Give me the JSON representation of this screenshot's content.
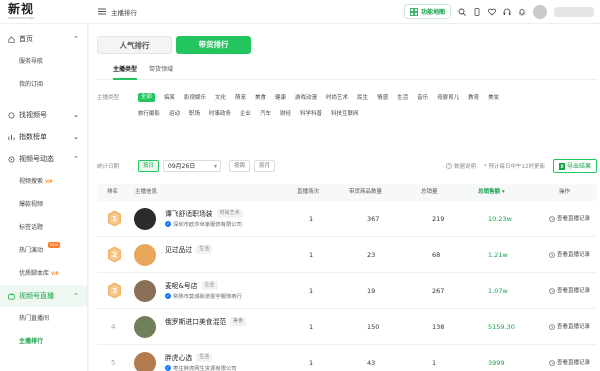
{
  "app": {
    "logo": "新视",
    "logo_sub": "XINSHIDATA.COM"
  },
  "topbar": {
    "breadcrumb_icon": "menu-icon",
    "breadcrumb": "主播排行",
    "func_button": "功能地图"
  },
  "sidebar": {
    "groups": [
      {
        "label": "首页",
        "icon": "home-icon",
        "items": [
          "服务导航",
          "我的订阅"
        ]
      },
      {
        "label": "找视频号",
        "icon": "search-circle-icon"
      },
      {
        "label": "指数榜单",
        "icon": "chart-icon"
      },
      {
        "label": "视频号动态",
        "icon": "video-icon",
        "items": [
          "视频搜索",
          "爆款视频",
          "标签话题",
          "热门演动",
          "优质脚本库"
        ],
        "vip": "VIP",
        "new": "NEW"
      },
      {
        "label": "视频号直播",
        "icon": "live-icon",
        "items": [
          "热门直播间",
          "主播排行"
        ]
      }
    ]
  },
  "main": {
    "tabs": [
      "人气排行",
      "带货排行"
    ],
    "subtabs": [
      "主播类型",
      "带货领域"
    ],
    "filter_label": "主播类型",
    "categories_row1": [
      "全部",
      "搞笑",
      "影视娱乐",
      "文化",
      "萌宠",
      "美食",
      "健康",
      "游戏动漫",
      "时尚艺术",
      "民生",
      "情感",
      "生活",
      "音乐",
      "母婴育儿",
      "教育",
      "美妆"
    ],
    "categories_row2": [
      "旅行摄影",
      "运动",
      "职场",
      "时事政务",
      "企业",
      "汽车",
      "财经",
      "科学科普",
      "科技互联网"
    ],
    "date_label": "统计日期",
    "date_modes": [
      "按日",
      "按周",
      "按月"
    ],
    "date_value": "09月26日",
    "data_note": "数据说明",
    "update_note": "* 预计每日中午12时更新",
    "export": "导出结果",
    "columns": [
      "排名",
      "主播信息",
      "直播场次",
      "带货商品数量",
      "总销量",
      "总销售额",
      "操作"
    ],
    "rows": [
      {
        "rank": "1",
        "name": "谭飞舒适职场装",
        "tag": "时尚艺术",
        "company": "深圳市欧莎世家服饰有限公司",
        "sessions": "1",
        "products": "367",
        "sales": "219",
        "gmv": "10.23w",
        "action": "查看直播记录"
      },
      {
        "rank": "2",
        "name": "见过品过",
        "tag": "生活",
        "company": "",
        "sessions": "1",
        "products": "23",
        "sales": "68",
        "gmv": "1.21w",
        "action": "查看直播记录"
      },
      {
        "rank": "3",
        "name": "麦呢&号店",
        "tag": "企业",
        "company": "常熟市莫城街道雯宇服饰商行",
        "sessions": "1",
        "products": "19",
        "sales": "267",
        "gmv": "1.07w",
        "action": "查看直播记录"
      },
      {
        "rank": "4",
        "name": "俄罗斯进口美食混范",
        "tag": "美食",
        "company": "",
        "sessions": "1",
        "products": "150",
        "sales": "138",
        "gmv": "5159.30",
        "action": "查看直播记录"
      },
      {
        "rank": "5",
        "name": "胖虎心选",
        "tag": "生活",
        "company": "枣庄胖虎网生资源有限公司",
        "sessions": "1",
        "products": "43",
        "sales": "1",
        "gmv": "3999",
        "action": "查看直播记录"
      }
    ]
  },
  "colors": {
    "accent": "#22c55e",
    "gold": "#f0a64a"
  }
}
